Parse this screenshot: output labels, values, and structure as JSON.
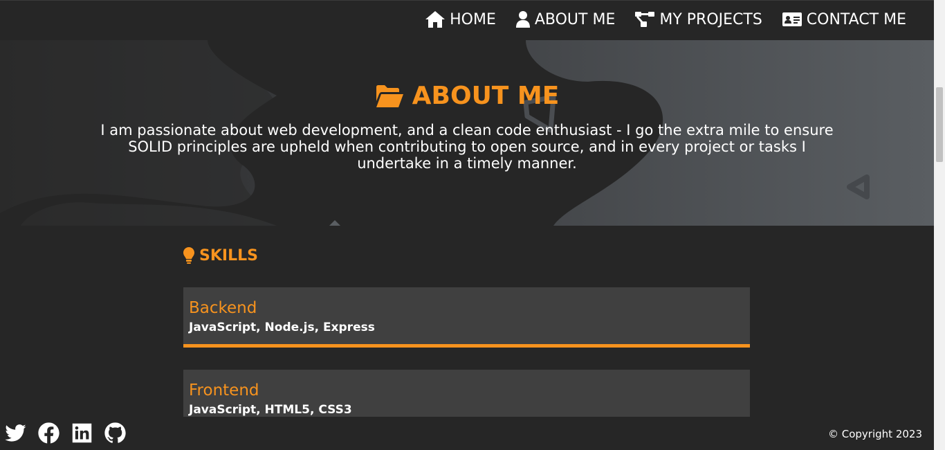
{
  "nav": {
    "items": [
      {
        "label": "HOME",
        "icon": "home-icon"
      },
      {
        "label": "ABOUT ME",
        "icon": "user-icon"
      },
      {
        "label": "MY PROJECTS",
        "icon": "project-diagram-icon"
      },
      {
        "label": "CONTACT ME",
        "icon": "id-card-icon"
      }
    ]
  },
  "hero": {
    "icon": "folder-open-icon",
    "title": "ABOUT ME",
    "text": "I am passionate about web development, and a clean code enthusiast - I go the extra mile to ensure SOLID principles are upheld when contributing to open source, and in every project or tasks I undertake in a timely manner."
  },
  "skills": {
    "icon": "lightbulb-icon",
    "heading": "SKILLS",
    "items": [
      {
        "title": "Backend",
        "list": "JavaScript, Node.js, Express"
      },
      {
        "title": "Frontend",
        "list": "JavaScript, HTML5, CSS3"
      }
    ]
  },
  "footer": {
    "socials": [
      "twitter-icon",
      "facebook-icon",
      "linkedin-icon",
      "github-icon"
    ],
    "copyright": "© Copyright 2023"
  },
  "colors": {
    "accent": "#f7931e",
    "background": "#262626",
    "card": "#404040"
  }
}
